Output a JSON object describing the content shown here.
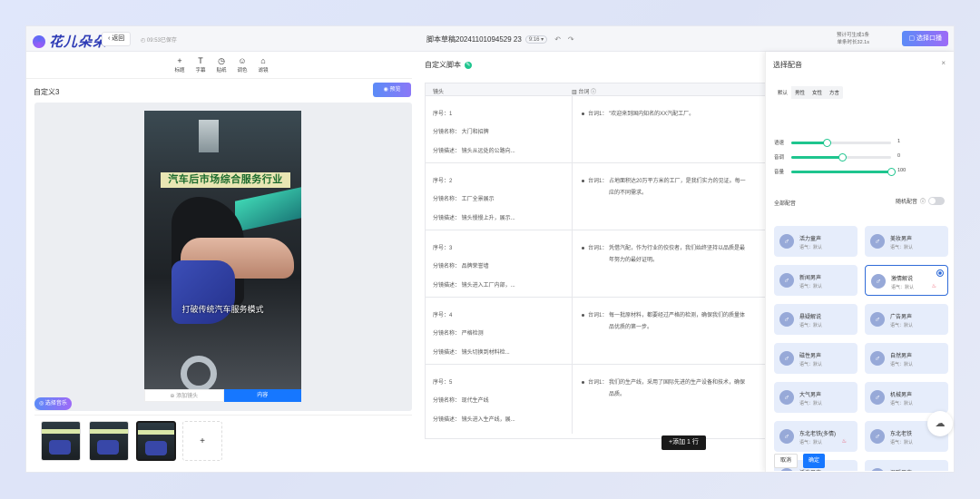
{
  "header": {
    "brand": "花儿朵朵",
    "back_label": "返回",
    "autosave": "09:53已保存",
    "doc_title": "脚本草稿20241101094529 23",
    "ratio": "9:16",
    "gen_info_1": "预计可生成1条",
    "gen_info_2": "单条时长32.1s",
    "gen_button": "选择口播"
  },
  "toolbar": {
    "tools": [
      {
        "icon": "+",
        "label": "标题"
      },
      {
        "icon": "T",
        "label": "字幕"
      },
      {
        "icon": "◷",
        "label": "贴纸"
      },
      {
        "icon": "☺",
        "label": "调色"
      },
      {
        "icon": "⌂",
        "label": "滤镜"
      }
    ]
  },
  "left": {
    "title": "自定义3",
    "preview_button": "预览",
    "video_banner": "汽车后市场综合服务行业",
    "video_caption": "打破传统汽车服务模式",
    "video_btn_left": "添加镜头",
    "video_btn_right": "内容",
    "music_button": "选择音乐",
    "add_thumb": "+"
  },
  "script": {
    "title": "自定义脚本",
    "col1": "镜头",
    "col2": "台词",
    "rows": [
      {
        "no": "序号：1",
        "name": "分镜名称：  大门和招牌",
        "desc": "分镜描述：  镜头从远处的公路向...",
        "line": "台词1：  \"欢迎来到国内知名的XX汽配工厂。"
      },
      {
        "no": "序号：2",
        "name": "分镜名称：  工厂全景展示",
        "desc": "分镜描述：  镜头慢慢上升，展示...",
        "line": "台词1：  占地面积达20万平方米的工厂，是我们实力的见证。每一",
        "line2": "应的不同需求。"
      },
      {
        "no": "序号：3",
        "name": "分镜名称：  品牌荣誉墙",
        "desc": "分镜描述：  镜头进入工厂内部，...",
        "line": "台词1：  凭借汽配，作为行业的佼佼者，我们始终坚持以品质是最",
        "line2": "年努力的最好证明。"
      },
      {
        "no": "序号：4",
        "name": "分镜名称：  严格检测",
        "desc": "分镜描述：  镜头切换到材料检...",
        "line": "台词1：  每一批原材料，都要经过严格的检测，确保我们的质量体",
        "line2": "品优质的第一步。"
      },
      {
        "no": "序号：5",
        "name": "分镜名称：  现代生产线",
        "desc": "分镜描述：  镜头进入生产线，展...",
        "line": "台词1：  我们的生产线，采用了国际先进的生产设备和技术，确保",
        "line2": "品质。"
      }
    ],
    "add_row": "+添加 1 行"
  },
  "panel": {
    "title": "选择配音",
    "close": "×",
    "tabs": [
      "默认",
      "男性",
      "女性",
      "方言"
    ],
    "sliders": [
      {
        "label": "语速",
        "value": "1",
        "fill": 0.35
      },
      {
        "label": "音调",
        "value": "0",
        "fill": 0.51
      },
      {
        "label": "音量",
        "value": "100",
        "fill": 1.0
      }
    ],
    "all_label": "全部配音",
    "random_label": "随机配音",
    "voices": [
      {
        "name": "活力童声",
        "desc": "语气：默认"
      },
      {
        "name": "美妆男声",
        "desc": "语气：默认"
      },
      {
        "name": "新闻男声",
        "desc": "语气：默认"
      },
      {
        "name": "激情解说",
        "desc": "语气：默认",
        "selected": true,
        "hot": true
      },
      {
        "name": "悬疑解说",
        "desc": "语气：默认"
      },
      {
        "name": "广告男声",
        "desc": "语气：默认"
      },
      {
        "name": "磁性男声",
        "desc": "语气：默认"
      },
      {
        "name": "自然男声",
        "desc": "语气：默认"
      },
      {
        "name": "大气男声",
        "desc": "语气：默认"
      },
      {
        "name": "机械男声",
        "desc": "语气：默认"
      },
      {
        "name": "东北老铁(多情)",
        "desc": "语气：默认",
        "hot": true
      },
      {
        "name": "东北老铁",
        "desc": "语气：默认"
      },
      {
        "name": "活泼男声",
        "desc": "语气：默认"
      },
      {
        "name": "温暖男声",
        "desc": "语气：默认"
      }
    ],
    "cancel": "取消",
    "confirm": "确定",
    "accent": "#1ec58e"
  }
}
